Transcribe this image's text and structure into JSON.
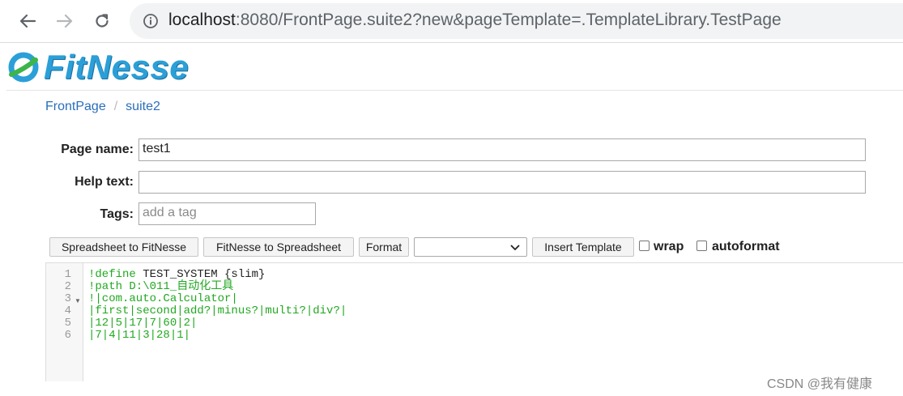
{
  "browser": {
    "url_host": "localhost",
    "url_rest": ":8080/FrontPage.suite2?new&pageTemplate=.TemplateLibrary.TestPage"
  },
  "header": {
    "logo_text": "FitNesse"
  },
  "breadcrumb": {
    "items": [
      "FrontPage",
      "suite2"
    ],
    "separator": "/"
  },
  "form": {
    "page_name_label": "Page name:",
    "page_name_value": "test1",
    "help_text_label": "Help text:",
    "help_text_value": "",
    "tags_label": "Tags:",
    "tags_placeholder": "add a tag"
  },
  "toolbar": {
    "spreadsheet_to_fitnesse": "Spreadsheet to FitNesse",
    "fitnesse_to_spreadsheet": "FitNesse to Spreadsheet",
    "format": "Format",
    "template_select_value": "",
    "insert_template": "Insert Template",
    "wrap_label": "wrap",
    "wrap_checked": false,
    "autoformat_label": "autoformat",
    "autoformat_checked": false
  },
  "editor": {
    "line_numbers": [
      "1",
      "2",
      "3",
      "4",
      "5",
      "6"
    ],
    "lines": [
      {
        "bang": "!define ",
        "rest": "TEST_SYSTEM {slim}"
      },
      {
        "bang": "!path D:\\011_自动化工具",
        "rest": ""
      },
      {
        "bang": "!|com.auto.Calculator|",
        "rest": ""
      },
      {
        "bang": "|first|second|add?|minus?|multi?|div?|",
        "rest": ""
      },
      {
        "bang": "|12|5|17|7|60|2|",
        "rest": ""
      },
      {
        "bang": "|7|4|11|3|28|1|",
        "rest": ""
      }
    ]
  },
  "watermark": "CSDN @我有健康",
  "colors": {
    "logo_blue": "#2b9fd8",
    "logo_green": "#3cb54a",
    "link_blue": "#2a6ebb",
    "code_green": "#22a822"
  }
}
